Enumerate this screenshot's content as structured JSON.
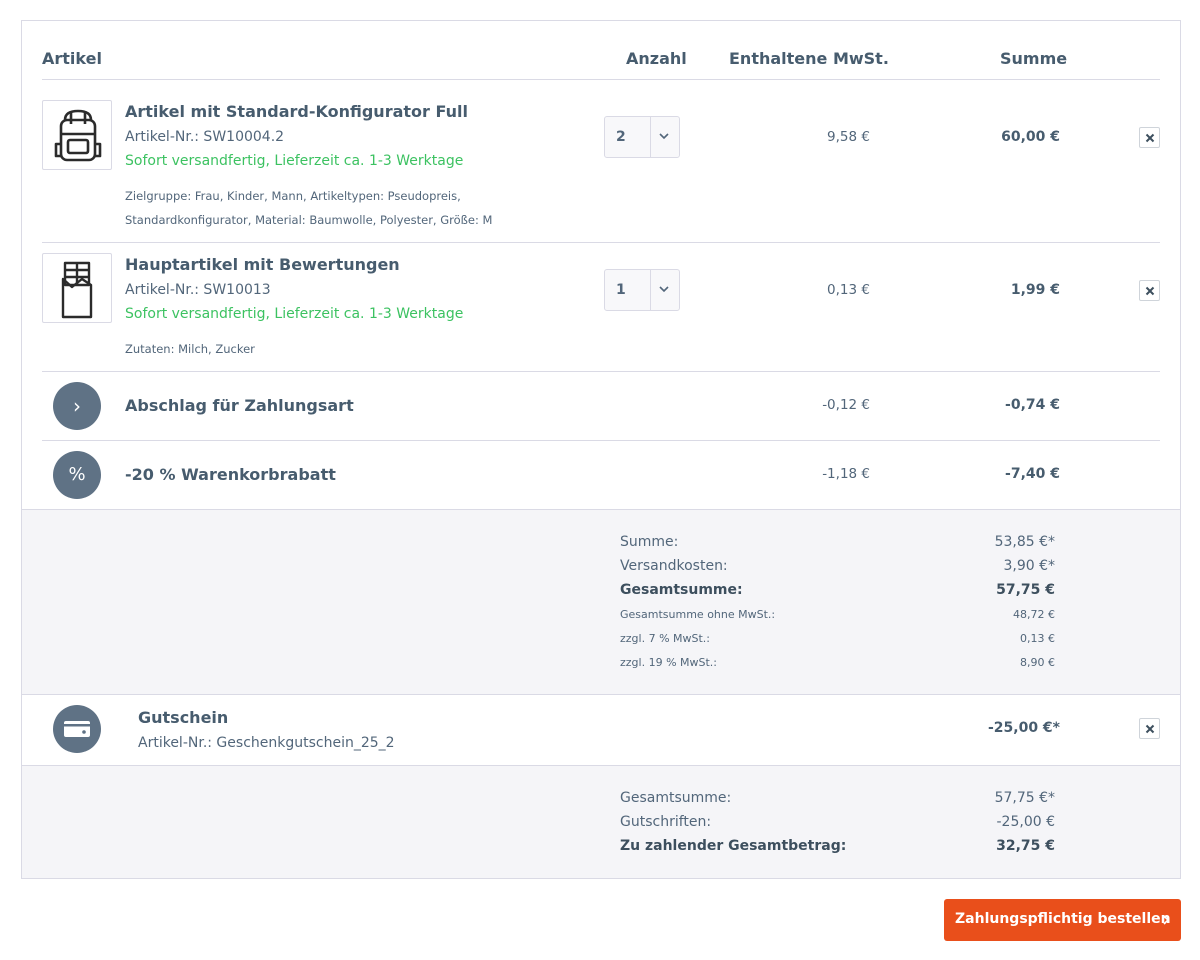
{
  "header": {
    "article": "Artikel",
    "quantity": "Anzahl",
    "vat": "Enthaltene MwSt.",
    "sum": "Summe"
  },
  "items": [
    {
      "icon": "backpack-icon",
      "title": "Artikel mit Standard-Konfigurator Full",
      "sku": "Artikel-Nr.: SW10004.2",
      "shipping": "Sofort versandfertig, Lieferzeit ca. 1-3 Werktage",
      "props_line1": "Zielgruppe: Frau, Kinder, Mann, Artikeltypen: Pseudopreis,",
      "props_line2": "Standardkonfigurator, Material: Baumwolle, Polyester, Größe: M",
      "quantity": "2",
      "vat": "9,58 €",
      "sum": "60,00 €"
    },
    {
      "icon": "chocolate-bar-icon",
      "title": "Hauptartikel mit Bewertungen",
      "sku": "Artikel-Nr.: SW10013",
      "shipping": "Sofort versandfertig, Lieferzeit ca. 1-3 Werktage",
      "props_line1": "Zutaten: Milch, Zucker",
      "quantity": "1",
      "vat": "0,13 €",
      "sum": "1,99 €"
    }
  ],
  "surcharge": {
    "icon": "chevron-right-icon",
    "glyph": "›",
    "title": "Abschlag für Zahlungsart",
    "vat": "-0,12 €",
    "sum": "-0,74 €"
  },
  "discount": {
    "icon": "percent-icon",
    "glyph": "%",
    "title": "-20 % Warenkorbrabatt",
    "vat": "-1,18 €",
    "sum": "-7,40 €"
  },
  "summary": {
    "subtotal_label": "Summe:",
    "subtotal_value": "53,85 €*",
    "shipping_label": "Versandkosten:",
    "shipping_value": "3,90 €*",
    "total_label": "Gesamtsumme:",
    "total_value": "57,75 €",
    "net_label": "Gesamtsumme ohne MwSt.:",
    "net_value": "48,72 €",
    "vat7_label": "zzgl. 7 % MwSt.:",
    "vat7_value": "0,13 €",
    "vat19_label": "zzgl. 19 % MwSt.:",
    "vat19_value": "8,90 €"
  },
  "voucher": {
    "icon": "gift-card-icon",
    "title": "Gutschein",
    "sku": "Artikel-Nr.: Geschenkgutschein_25_2",
    "sum": "-25,00 €*"
  },
  "final": {
    "total_label": "Gesamtsumme:",
    "total_value": "57,75 €*",
    "credit_label": "Gutschriften:",
    "credit_value": "-25,00 €",
    "due_label": "Zu zahlender Gesamtbetrag:",
    "due_value": "32,75 €"
  },
  "order_button": {
    "label": "Zahlungspflichtig bestellen",
    "icon": "chevron-right-icon"
  },
  "colors": {
    "accent": "#e94f1b",
    "success": "#3cc261",
    "text": "#52667a",
    "icon_circle": "#5f7285"
  }
}
